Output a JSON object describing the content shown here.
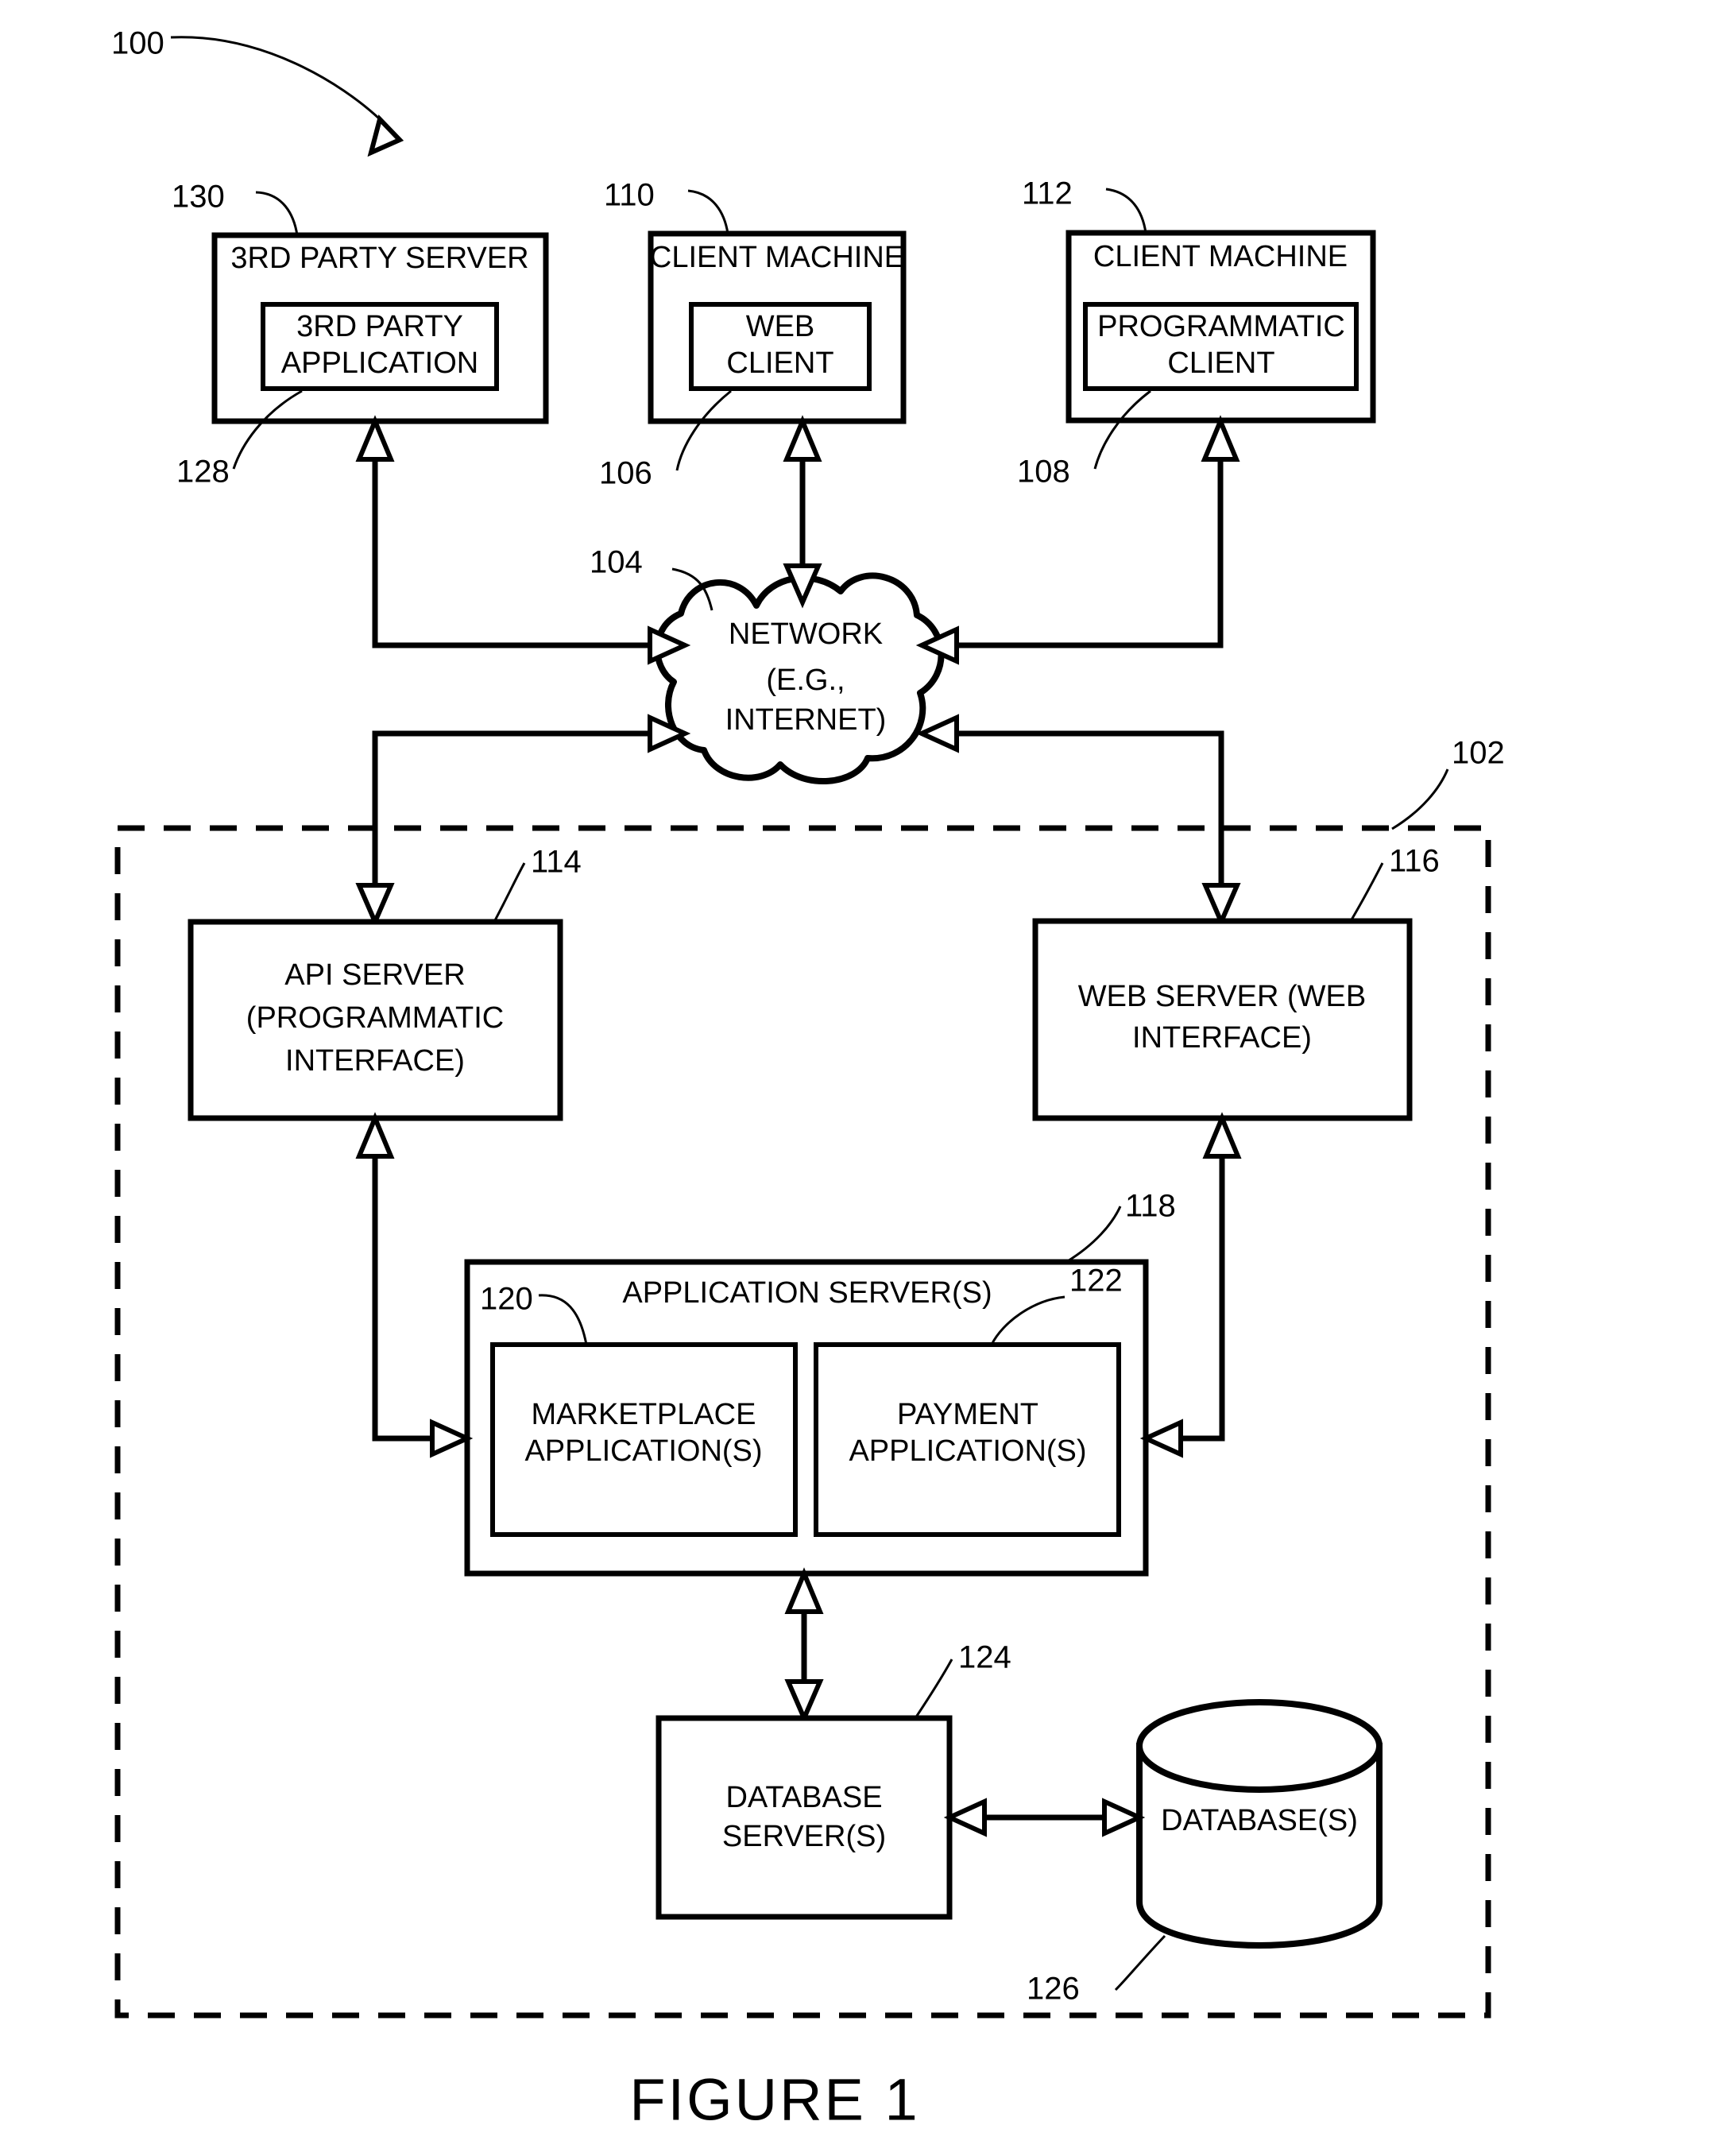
{
  "figure": {
    "caption": "FIGURE 1",
    "system_ref": "100"
  },
  "nodes": {
    "third_party_server": {
      "ref": "130",
      "title": "3RD PARTY SERVER",
      "inner": {
        "ref": "128",
        "line1": "3RD PARTY",
        "line2": "APPLICATION"
      }
    },
    "client_machine_web": {
      "ref": "110",
      "title": "CLIENT MACHINE",
      "inner": {
        "ref": "106",
        "line1": "WEB",
        "line2": "CLIENT"
      }
    },
    "client_machine_prog": {
      "ref": "112",
      "title": "CLIENT MACHINE",
      "inner": {
        "ref": "108",
        "line1": "PROGRAMMATIC",
        "line2": "CLIENT"
      }
    },
    "network": {
      "ref": "104",
      "line1": "NETWORK",
      "line2": "(E.G.,",
      "line3": "INTERNET)"
    },
    "networked_system": {
      "ref": "102"
    },
    "api_server": {
      "ref": "114",
      "line1": "API SERVER",
      "line2": "(PROGRAMMATIC",
      "line3": "INTERFACE)"
    },
    "web_server": {
      "ref": "116",
      "line1": "WEB SERVER (WEB",
      "line2": "INTERFACE)"
    },
    "application_server": {
      "ref": "118",
      "title": "APPLICATION SERVER(S)",
      "marketplace": {
        "ref": "120",
        "line1": "MARKETPLACE",
        "line2": "APPLICATION(S)"
      },
      "payment": {
        "ref": "122",
        "line1": "PAYMENT",
        "line2": "APPLICATION(S)"
      }
    },
    "database_server": {
      "ref": "124",
      "line1": "DATABASE",
      "line2": "SERVER(S)"
    },
    "databases": {
      "ref": "126",
      "line1": "DATABASE(S)"
    }
  },
  "colors": {
    "ink": "#000000",
    "paper": "#ffffff"
  }
}
